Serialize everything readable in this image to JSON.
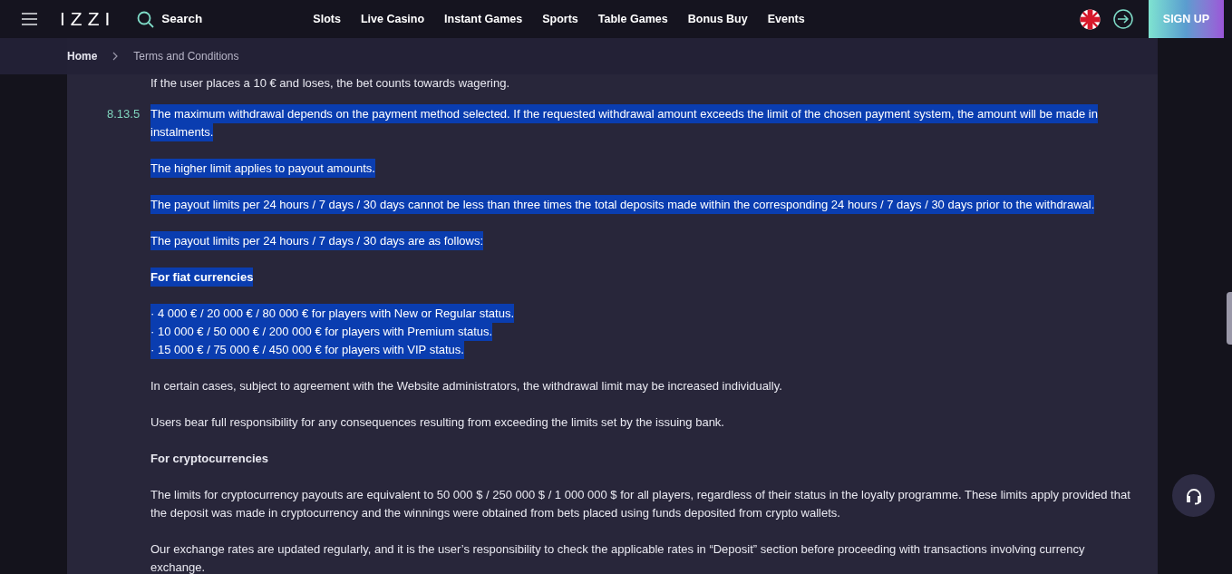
{
  "header": {
    "logo": "IZZI",
    "search": "Search",
    "nav": [
      {
        "label": "Slots"
      },
      {
        "label": "Live Casino"
      },
      {
        "label": "Instant Games"
      },
      {
        "label": "Sports"
      },
      {
        "label": "Table Games"
      },
      {
        "label": "Bonus Buy"
      },
      {
        "label": "Events"
      }
    ],
    "signup": "SIGN UP"
  },
  "breadcrumb": [
    {
      "label": "Home"
    },
    {
      "label": "Terms and Conditions"
    }
  ],
  "content": {
    "intro": "If the user places a 10 € and loses, the bet counts towards wagering.",
    "clause": {
      "number": "8.13.5",
      "paragraphs": [
        {
          "kind": "text",
          "selected": true,
          "text": "The maximum withdrawal depends on the payment method selected. If the requested withdrawal amount exceeds the limit of the chosen payment system, the amount will be made in instalments."
        },
        {
          "kind": "text",
          "selected": true,
          "text": "The higher limit applies to payout amounts."
        },
        {
          "kind": "text",
          "selected": true,
          "text": "The payout limits per 24 hours / 7 days / 30 days cannot be less than three times the total deposits made within the corresponding 24 hours / 7 days / 30 days prior to the withdrawal."
        },
        {
          "kind": "text",
          "selected": true,
          "text": "The payout limits per 24 hours / 7 days / 30 days are as follows:"
        },
        {
          "kind": "heading",
          "selected": true,
          "text": "For fiat currencies"
        },
        {
          "kind": "bullet",
          "selected": true,
          "text": "· 4 000 € / 20 000 € / 80 000 € for players with New or Regular status."
        },
        {
          "kind": "bullet",
          "selected": true,
          "text": "· 10 000 € / 50 000 € / 200 000 € for players with Premium status."
        },
        {
          "kind": "bullet",
          "selected": true,
          "text": "· 15 000 € / 75 000 € / 450 000 € for players with VIP status."
        },
        {
          "kind": "text",
          "selected": false,
          "text": "In certain cases, subject to agreement with the Website administrators, the withdrawal limit may be increased individually."
        },
        {
          "kind": "text",
          "selected": false,
          "text": "Users bear full responsibility for any consequences resulting from exceeding the limits set by the issuing bank."
        },
        {
          "kind": "heading",
          "selected": false,
          "text": "For cryptocurrencies"
        },
        {
          "kind": "text",
          "selected": false,
          "text": "The limits for cryptocurrency payouts are equivalent to 50 000 $ / 250 000 $ / 1 000 000 $ for all players, regardless of their status in the loyalty programme. These limits apply provided that the deposit was made in cryptocurrency and the winnings were obtained from bets placed using funds deposited from crypto wallets."
        },
        {
          "kind": "text",
          "selected": false,
          "text": "Our exchange rates are updated regularly, and it is the user’s responsibility to check the applicable rates in “Deposit” section before proceeding with transactions involving currency exchange."
        }
      ]
    }
  }
}
